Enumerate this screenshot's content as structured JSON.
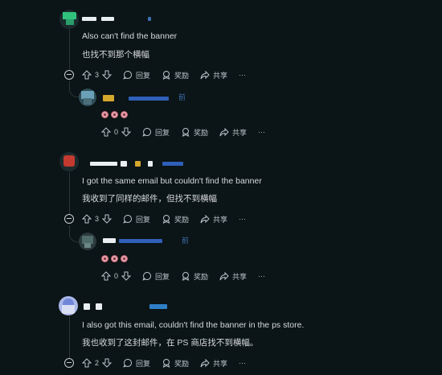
{
  "comments": [
    {
      "text_en": "Also can't find the banner",
      "text_zh": "也找不到那个横幅",
      "votes": "3",
      "reply_label": "回复",
      "award_label": "奖励",
      "share_label": "共享",
      "more_label": "···",
      "reply": {
        "timestamp": "前",
        "votes": "0",
        "reply_label": "回复",
        "award_label": "奖励",
        "share_label": "共享",
        "more_label": "···"
      }
    },
    {
      "text_en": "I got the same email but couldn't find the banner",
      "text_zh": "我收到了同样的邮件，但找不到横幅",
      "votes": "3",
      "reply_label": "回复",
      "award_label": "奖励",
      "share_label": "共享",
      "more_label": "···",
      "reply": {
        "timestamp": "前",
        "votes": "0",
        "reply_label": "回复",
        "award_label": "奖励",
        "share_label": "共享",
        "more_label": "···"
      }
    },
    {
      "text_en": "I also got this email, couldn't find the banner in the ps store.",
      "text_zh": "我也收到了这封邮件，在 PS 商店找不到横幅。",
      "votes": "2",
      "reply_label": "回复",
      "award_label": "奖励",
      "share_label": "共享",
      "more_label": "···"
    }
  ],
  "colors": {
    "background": "#0b1416",
    "text": "#d7dadc",
    "muted": "#b8c5c9",
    "thread_line": "#2b3436"
  }
}
